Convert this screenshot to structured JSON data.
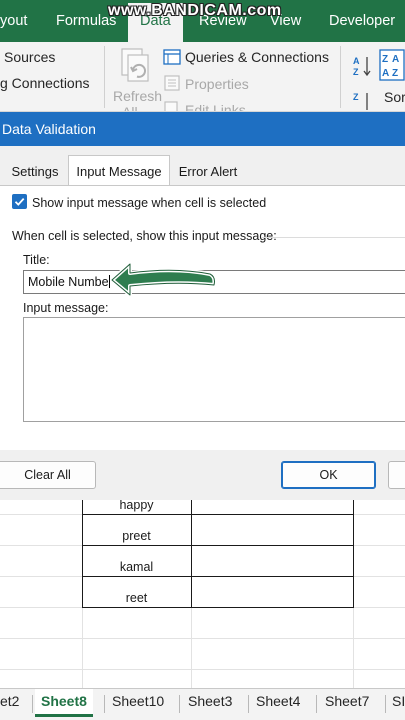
{
  "ribbon_tabs": {
    "layout": "yout",
    "formulas": "Formulas",
    "data": "Data",
    "review": "Review",
    "view": "View",
    "developer": "Developer"
  },
  "watermark": "www.BANDICAM.com",
  "ribbon": {
    "sources": "Sources",
    "connections": "g Connections",
    "refresh_all": "Refresh",
    "refresh_all_2": "All",
    "queries_connections": "Queries & Connections",
    "properties": "Properties",
    "edit_links": "Edit Links",
    "sort": "Sor"
  },
  "dialog": {
    "title": "Data Validation",
    "tabs": [
      "Settings",
      "Input Message",
      "Error Alert"
    ],
    "show_message_label": "Show input message when cell is selected",
    "section_label": "When cell is selected, show this input message:",
    "title_label": "Title:",
    "title_value": "Mobile Numbe",
    "input_message_label": "Input message:",
    "input_message_value": "",
    "clear_all": "Clear All",
    "ok": "OK",
    "show_message_checked": true
  },
  "sheet": {
    "names": [
      "happy",
      "preet",
      "kamal",
      "reet"
    ]
  },
  "sheet_tabs": [
    "et2",
    "Sheet8",
    "Sheet10",
    "Sheet3",
    "Sheet4",
    "Sheet7",
    "SI"
  ],
  "colors": {
    "excel_green": "#217346",
    "dialog_blue": "#1e6fc2",
    "arrow_green": "#2e7d4f"
  }
}
